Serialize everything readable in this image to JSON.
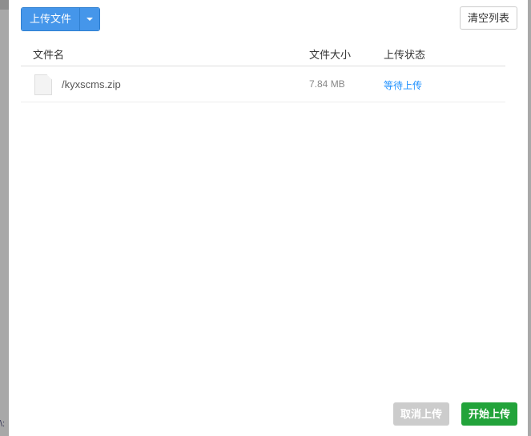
{
  "toolbar": {
    "upload_label": "上传文件",
    "clear_label": "清空列表"
  },
  "table": {
    "headers": [
      "文件名",
      "文件大小",
      "上传状态"
    ],
    "rows": [
      {
        "name": "/kyxscms.zip",
        "size": "7.84 MB",
        "status": "等待上传"
      }
    ]
  },
  "footer": {
    "cancel_label": "取消上传",
    "start_label": "开始上传"
  },
  "background": {
    "partial_text": "\\:"
  },
  "colors": {
    "primary": "#4596ea",
    "success": "#22a33a",
    "status": "#1e90ff"
  }
}
